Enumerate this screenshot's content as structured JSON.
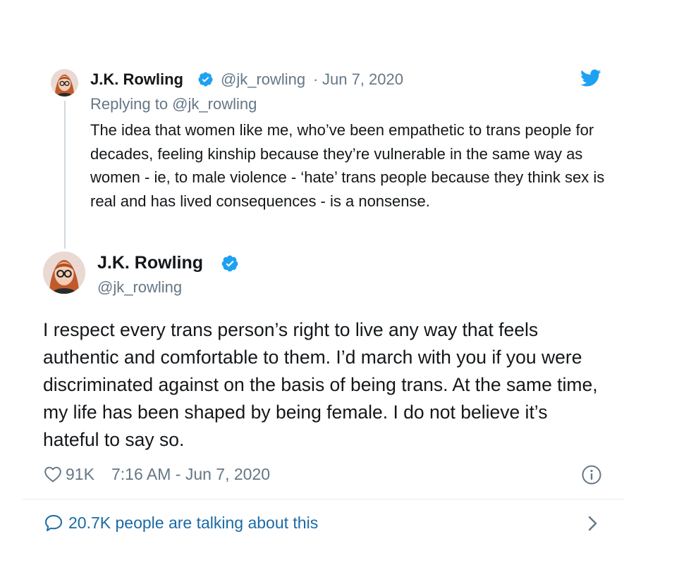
{
  "reply_tweet": {
    "author_name": "J.K. Rowling",
    "handle": "@jk_rowling",
    "separator": "·",
    "date": "Jun 7, 2020",
    "replying_to": "Replying to @jk_rowling",
    "text": "The idea that women like me, who’ve been empathetic to trans people for decades, feeling kinship because they’re vulnerable in the same way as women - ie, to male violence - ‘hate’ trans people because they think sex is real and has lived consequences - is a nonsense.",
    "icons": {
      "avatar": "avatar-photo",
      "verified": "verified-badge-icon",
      "brand": "twitter-bird-icon"
    }
  },
  "main_tweet": {
    "author_name": "J.K. Rowling",
    "handle": "@jk_rowling",
    "text": "I respect every trans person’s right to live any way that feels authentic and comfortable to them. I’d march with you if you were discriminated against on the basis of being trans. At the same time, my life has been shaped by being female. I do not believe it’s hateful to say so.",
    "likes": "91K",
    "timestamp": "7:16 AM - Jun 7, 2020",
    "icons": {
      "like": "heart-icon",
      "info": "info-icon"
    }
  },
  "footer": {
    "talking_text": "20.7K people are talking about this",
    "icons": {
      "reply": "speech-bubble-icon",
      "more": "chevron-right-icon"
    }
  },
  "colors": {
    "twitter_blue": "#1da1f2",
    "link_blue": "#1b6aa5",
    "secondary_text": "#657786",
    "verified": "#1da1f2"
  }
}
